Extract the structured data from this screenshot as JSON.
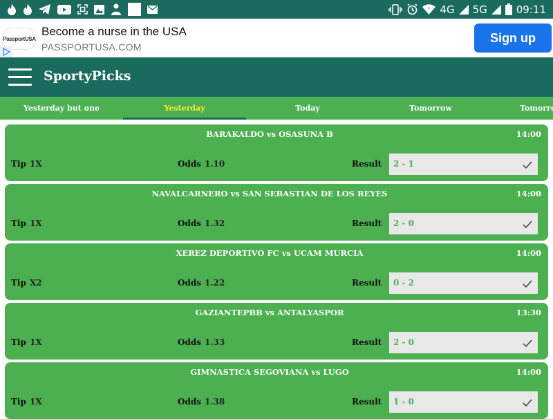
{
  "status_bar": {
    "time": "09:11",
    "network_1": "4G",
    "network_2": "5G"
  },
  "ad": {
    "logo_text": "PassportUSA",
    "title": "Become a nurse in the USA",
    "url": "PASSPORTUSA.COM",
    "cta": "Sign up"
  },
  "app": {
    "title": "SportyPicks"
  },
  "tabs": [
    {
      "label": "Yesterday but one",
      "active": false
    },
    {
      "label": "Yesterday",
      "active": true
    },
    {
      "label": "Today",
      "active": false
    },
    {
      "label": "Tomorrow",
      "active": false
    },
    {
      "label": "Tomorrow",
      "active": false
    }
  ],
  "labels": {
    "tip": "Tip",
    "odds": "Odds",
    "result": "Result"
  },
  "matches": [
    {
      "match": "BARAKALDO vs OSASUNA B",
      "time": "14:00",
      "tip": "1X",
      "odds": "1.10",
      "result": "2 - 1"
    },
    {
      "match": "NAVALCARNERO vs SAN SEBASTIAN DE LOS REYES",
      "time": "14:00",
      "tip": "1X",
      "odds": "1.32",
      "result": "2 - 0"
    },
    {
      "match": "XEREZ DEPORTIVO FC vs UCAM MURCIA",
      "time": "14:00",
      "tip": "X2",
      "odds": "1.22",
      "result": "0 - 2"
    },
    {
      "match": "GAZIANTEPBB vs ANTALYASPOR",
      "time": "13:30",
      "tip": "1X",
      "odds": "1.33",
      "result": "2 - 0"
    },
    {
      "match": "GIMNASTICA SEGOVIANA vs LUGO",
      "time": "14:00",
      "tip": "1X",
      "odds": "1.38",
      "result": "1 - 0"
    }
  ],
  "icons": {
    "status_left": [
      "fire-icon",
      "fire-icon",
      "telegram-icon",
      "youtube-icon",
      "qr-scan-icon",
      "image-icon",
      "person-icon",
      "square-icon",
      "mail-icon"
    ],
    "status_right": [
      "vibrate-icon",
      "alarm-icon",
      "wifi-icon",
      "signal-icon",
      "battery-icon"
    ],
    "result_status": "check-icon"
  },
  "colors": {
    "primary": "#1a6b5e",
    "card": "#4caf50",
    "active_tab": "#ffeb3b",
    "cta": "#1a73e8"
  }
}
